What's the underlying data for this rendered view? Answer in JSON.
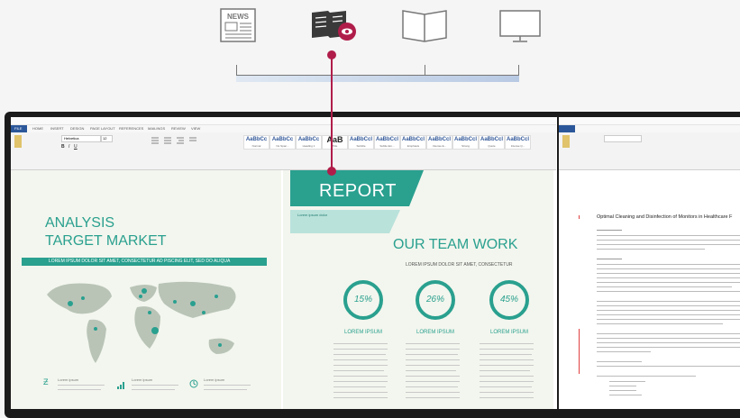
{
  "modes": {
    "news_label": "NEWS",
    "items": [
      {
        "name": "newspaper-mode-icon",
        "icon": "newspaper"
      },
      {
        "name": "reader-eye-mode-icon",
        "icon": "book-eye"
      },
      {
        "name": "open-book-mode-icon",
        "icon": "open-book"
      },
      {
        "name": "monitor-mode-icon",
        "icon": "monitor"
      }
    ]
  },
  "colors": {
    "accent": "#b01d4a",
    "teal": "#2aa08f",
    "slider": "#b8c9e3"
  },
  "ribbon": {
    "tabs": [
      "FILE",
      "HOME",
      "INSERT",
      "DESIGN",
      "PAGE LAYOUT",
      "REFERENCES",
      "MAILINGS",
      "REVIEW",
      "VIEW"
    ],
    "styles": [
      "AaBbCc",
      "AaBbCc",
      "AaBbCc",
      "AaB",
      "AaBbCcl",
      "AaBbCcl",
      "AaBbCcl",
      "AaBbCcl",
      "AaBbCcl",
      "AaBbCcl",
      "AaBbCcl"
    ],
    "style_names": [
      "Normal",
      "No Spac...",
      "Heading 1",
      "Title",
      "Subtitle",
      "Subtle Em...",
      "Emphasis",
      "Intense E...",
      "Strong",
      "Quote",
      "Intense Q..."
    ],
    "font_name": "Helvetica",
    "font_size": "12"
  },
  "doc_left": {
    "heading_line1": "ANALYSIS",
    "heading_line2": "TARGET MARKET",
    "banner": "LOREM IPSUM DOLOR SIT AMET, CONSECTETUR AD PISCING ELIT, SED DO ALIQUA",
    "legend": [
      "Lorem ipsum",
      "Lorem ipsum",
      "Lorem ipsum"
    ]
  },
  "doc_center": {
    "report": "REPORT",
    "report_sub": "Lorem ipsum dolor",
    "team_title": "OUR TEAM WORK",
    "team_sub": "LOREM IPSUM DOLOR SIT AMET, CONSECTETUR",
    "stats": [
      {
        "value": "15%",
        "fraction": 0.15,
        "label": "LOREM IPSUM"
      },
      {
        "value": "26%",
        "fraction": 0.26,
        "label": "LOREM IPSUM"
      },
      {
        "value": "45%",
        "fraction": 0.45,
        "label": "LOREM IPSUM"
      }
    ]
  },
  "doc_right": {
    "title": "Optimal Cleaning and Disinfection of Monitors in Healthcare F"
  }
}
